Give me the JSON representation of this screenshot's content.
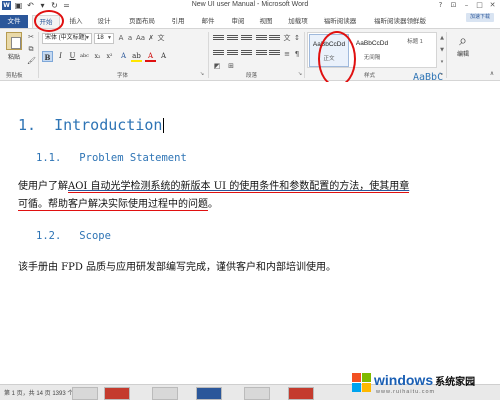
{
  "window": {
    "title": "New UI user Manual - Microsoft Word",
    "help": "?",
    "login": "加速下载"
  },
  "tabs": [
    "文件",
    "开始",
    "插入",
    "设计",
    "页面布局",
    "引用",
    "邮件",
    "审阅",
    "视图",
    "加载项",
    "福昕阅读器",
    "福昕阅读器领鲜版"
  ],
  "ribbon": {
    "paste_label": "粘贴",
    "clipboard_group": "剪贴板",
    "font_name": "宋体 (中文标题)",
    "font_size": "18",
    "font_group": "字体",
    "paragraph_group": "段落",
    "styles_group": "样式",
    "styles": [
      {
        "sample": "AaBbCcDd",
        "name": "正文"
      },
      {
        "sample": "AaBbCcDd",
        "name": "无间隔"
      },
      {
        "sample": "AaBbC",
        "name": "标题 1"
      }
    ],
    "edit_label": "编辑"
  },
  "document": {
    "h1_num": "1.",
    "h1_text": "Introduction",
    "h2a_num": "1.1.",
    "h2a_text": "Problem Statement",
    "para1_pre": "使用户了解",
    "para1_link": "AOI 自动光学检测系统的新版本 UI 的使用条件和参数配置的方法，使其用章",
    "para1_line2": "可循。帮助客户解决实际使用过程中的问题",
    "para1_end": "。",
    "h2b_num": "1.2.",
    "h2b_text": "Scope",
    "para2": "该手册由 FPD 品质与应用研发部编写完成，谨供客户和内部培训使用。"
  },
  "status": {
    "text": "第 1 页，共 14 页    1393 个字"
  },
  "watermark": {
    "brand": "windows",
    "suffix": "系统家园",
    "url": "www.ruihaitu.com"
  }
}
